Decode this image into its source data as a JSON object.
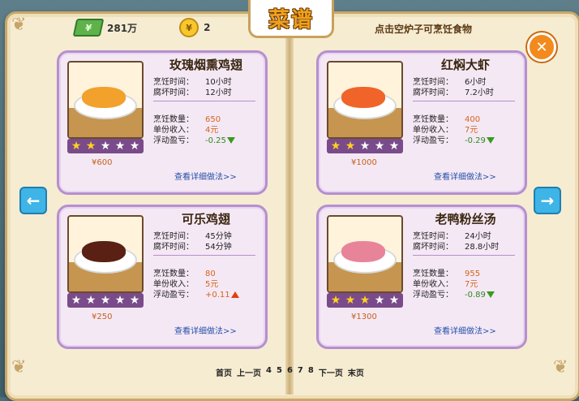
{
  "header": {
    "cash_value": "281万",
    "coin_value": "2",
    "title": "菜谱",
    "hint": "点击空炉子可烹饪食物",
    "close_label": "✕"
  },
  "nav": {
    "prev": "←",
    "next": "→"
  },
  "labels": {
    "cook_time": "烹饪时间：",
    "spoil_time": "腐坏时间：",
    "cook_count": "烹饪数量：",
    "unit_income": "单份收入：",
    "profit": "浮动盈亏：",
    "detail": "查看详细做法>>"
  },
  "recipes": [
    {
      "name": "玫瑰烟熏鸡翅",
      "cook_time": "10小时",
      "spoil_time": "12小时",
      "count": "650",
      "income": "4元",
      "profit": "-0.25",
      "trend": "down",
      "price": "¥600",
      "stars": 2,
      "food_color": "#f2a12c"
    },
    {
      "name": "红焖大虾",
      "cook_time": "6小时",
      "spoil_time": "7.2小时",
      "count": "400",
      "income": "7元",
      "profit": "-0.29",
      "trend": "down",
      "price": "¥1000",
      "stars": 2,
      "food_color": "#f0642a"
    },
    {
      "name": "可乐鸡翅",
      "cook_time": "45分钟",
      "spoil_time": "54分钟",
      "count": "80",
      "income": "5元",
      "profit": "+0.11",
      "trend": "up",
      "price": "¥250",
      "stars": 0,
      "food_color": "#5a2014"
    },
    {
      "name": "老鸭粉丝汤",
      "cook_time": "24小时",
      "spoil_time": "28.8小时",
      "count": "955",
      "income": "7元",
      "profit": "-0.89",
      "trend": "down",
      "price": "¥1300",
      "stars": 3,
      "food_color": "#e8849a"
    }
  ],
  "pager": [
    "首页",
    "上一页",
    "4",
    "5",
    "6",
    "7",
    "8",
    "下一页",
    "末页"
  ]
}
